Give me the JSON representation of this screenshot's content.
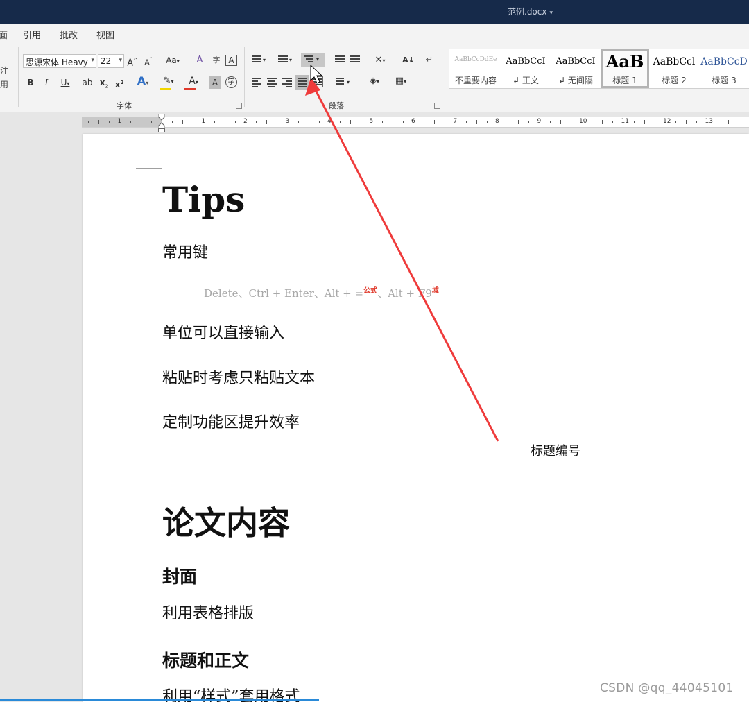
{
  "window": {
    "title": "范例.docx"
  },
  "menu": {
    "tabs": [
      "面",
      "引用",
      "批改",
      "视图"
    ]
  },
  "ribbon": {
    "left_stub": [
      "注",
      "用"
    ],
    "font": {
      "family": "思源宋体 Heavy",
      "size": "22",
      "grow_glyph": "A",
      "shrink_glyph": "A",
      "case_glyph": "Aa",
      "clear_glyph": "A",
      "phonetic_glyph": "字",
      "border_glyph": "A",
      "bold": "B",
      "italic": "I",
      "underline": "U",
      "strike": "ab",
      "subscript": "x",
      "superscript": "x",
      "effects_glyph": "A",
      "highlight_glyph": "✎",
      "color_glyph": "A",
      "shade_glyph": "A",
      "enclose_glyph": "字",
      "group_label": "字体",
      "font_color": "#e0392b",
      "highlight_color": "#f2d600"
    },
    "paragraph": {
      "group_label": "段落",
      "sort_glyph": "A↓",
      "show_marks_glyph": "↵"
    },
    "styles": [
      {
        "sample": "AaBbCcDdEe",
        "name": "不重要内容"
      },
      {
        "sample": "AaBbCcI",
        "name": "↲ 正文"
      },
      {
        "sample": "AaBbCcI",
        "name": "↲ 无间隔"
      },
      {
        "sample": "AaB",
        "name": "标题 1",
        "selected": true
      },
      {
        "sample": "AaBbCcl",
        "name": "标题 2"
      },
      {
        "sample": "AaBbCcD",
        "name": "标题 3"
      }
    ]
  },
  "ruler": {
    "labels": [
      "1",
      "1",
      "2",
      "3",
      "4",
      "5",
      "6",
      "7",
      "8",
      "9",
      "10",
      "11",
      "12",
      "13"
    ]
  },
  "document": {
    "h1_tips": "Tips",
    "common_keys": "常用键",
    "shortcut_line": {
      "part1": "Delete、Ctrl + Enter、Alt + =",
      "sup1": "公式",
      "part2": "、Alt + F9",
      "sup2": "域"
    },
    "line_units": "单位可以直接输入",
    "line_paste": "粘贴时考虑只粘贴文本",
    "line_ribbon": "定制功能区提升效率",
    "h1_content": "论文内容",
    "h2_cover": "封面",
    "line_table": "利用表格排版",
    "h2_title_body": "标题和正文",
    "line_styles": "利用“样式”套用格式"
  },
  "annotation": {
    "text": "标题编号",
    "arrow_color": "#ef3b3b"
  },
  "watermark": "CSDN @qq_44045101"
}
